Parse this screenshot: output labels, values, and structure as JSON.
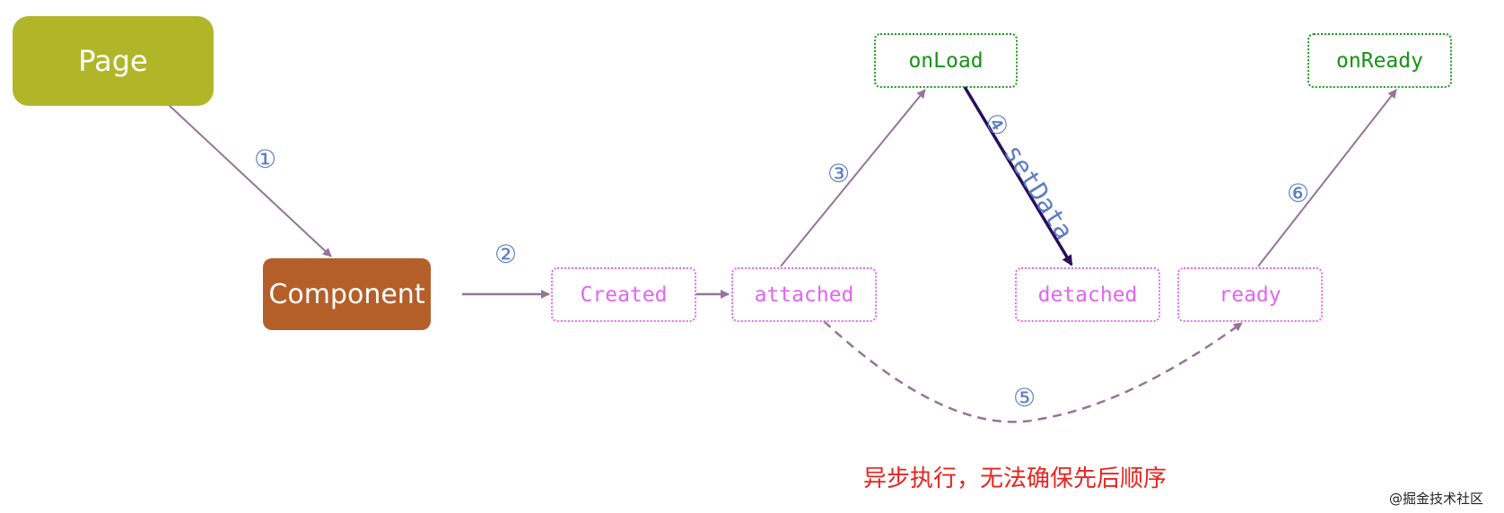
{
  "nodes": {
    "page": "Page",
    "component": "Component",
    "created": "Created",
    "attached": "attached",
    "onload": "onLoad",
    "detached": "detached",
    "ready": "ready",
    "onready": "onReady"
  },
  "steps": {
    "s1": "①",
    "s2": "②",
    "s3": "③",
    "s4": "④ setData",
    "s5": "⑤",
    "s6": "⑥"
  },
  "edges": [
    {
      "from": "Page",
      "to": "Component",
      "step": "①",
      "style": "solid"
    },
    {
      "from": "Component",
      "to": "Created",
      "step": "②",
      "style": "solid"
    },
    {
      "from": "Created",
      "to": "attached",
      "step": "",
      "style": "solid"
    },
    {
      "from": "attached",
      "to": "onLoad",
      "step": "③",
      "style": "solid"
    },
    {
      "from": "onLoad",
      "to": "detached",
      "step": "④ setData",
      "style": "bold"
    },
    {
      "from": "attached",
      "to": "ready",
      "step": "⑤",
      "style": "dashed"
    },
    {
      "from": "ready",
      "to": "onReady",
      "step": "⑥",
      "style": "solid"
    }
  ],
  "note": "异步执行，无法确保先后顺序",
  "watermark": "@掘金技术社区",
  "colors": {
    "page": "#b1b628",
    "component": "#b45f2a",
    "page_hooks": "#169216",
    "component_hooks": "#e264f5",
    "arrow": "#96739a",
    "bold_arrow": "#2a0d5c",
    "step_label": "#5a7cc8",
    "note": "#e8231e"
  }
}
